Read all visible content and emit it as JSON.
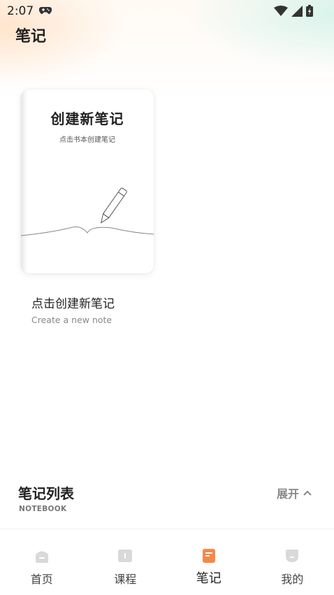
{
  "status_bar": {
    "time": "2:07"
  },
  "page": {
    "title": "笔记"
  },
  "new_note_card": {
    "book_title": "创建新笔记",
    "book_subtitle": "点击书本创建笔记",
    "label": "点击创建新笔记",
    "sublabel": "Create a new note"
  },
  "notebook_list": {
    "title": "笔记列表",
    "subtitle": "NOTEBOOK",
    "expand_label": "展开"
  },
  "tabbar": {
    "tabs": [
      {
        "label": "首页",
        "icon": "home-icon"
      },
      {
        "label": "课程",
        "icon": "course-icon"
      },
      {
        "label": "笔记",
        "icon": "notes-icon",
        "active": true
      },
      {
        "label": "我的",
        "icon": "profile-icon"
      }
    ],
    "active_color": "#f5894b",
    "inactive_icon_color": "#d9d9d9"
  }
}
